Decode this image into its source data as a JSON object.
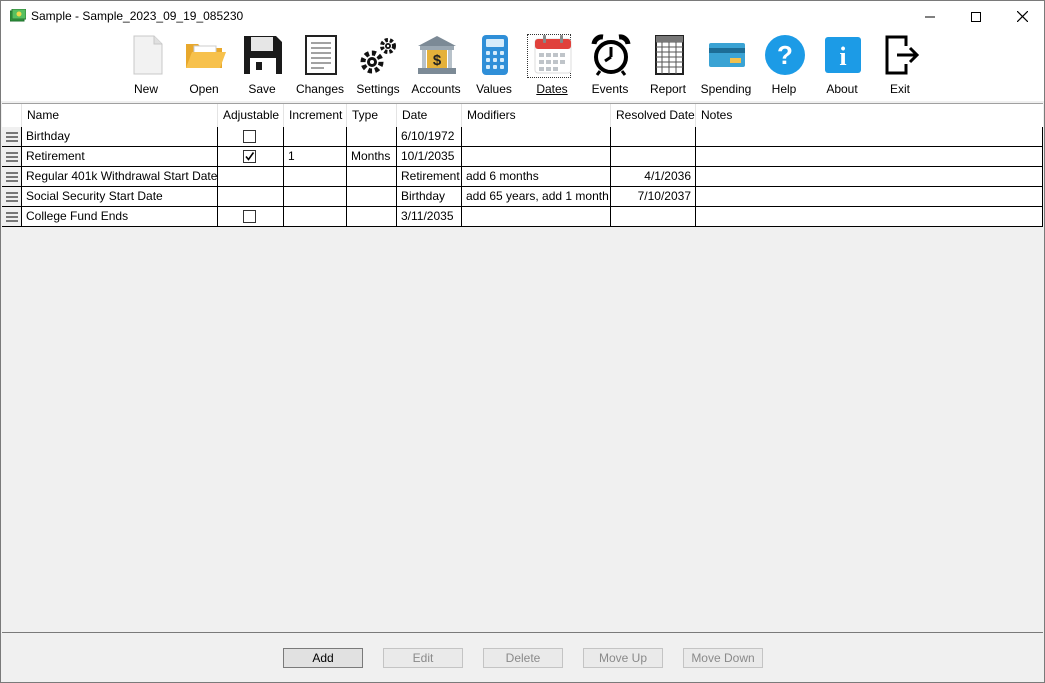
{
  "window": {
    "title": "Sample - Sample_2023_09_19_085230"
  },
  "toolbar": {
    "items": [
      {
        "label": "New",
        "icon": "new-file-icon"
      },
      {
        "label": "Open",
        "icon": "folder-open-icon"
      },
      {
        "label": "Save",
        "icon": "floppy-disk-icon"
      },
      {
        "label": "Changes",
        "icon": "document-changes-icon"
      },
      {
        "label": "Settings",
        "icon": "gears-icon"
      },
      {
        "label": "Accounts",
        "icon": "bank-icon"
      },
      {
        "label": "Values",
        "icon": "calculator-icon"
      },
      {
        "label": "Dates",
        "icon": "calendar-icon",
        "active": true
      },
      {
        "label": "Events",
        "icon": "alarm-clock-icon"
      },
      {
        "label": "Report",
        "icon": "spreadsheet-icon"
      },
      {
        "label": "Spending",
        "icon": "credit-card-icon"
      },
      {
        "label": "Help",
        "icon": "help-icon"
      },
      {
        "label": "About",
        "icon": "info-icon"
      },
      {
        "label": "Exit",
        "icon": "exit-icon"
      }
    ]
  },
  "grid": {
    "columns": [
      "Name",
      "Adjustable",
      "Increment",
      "Type",
      "Date",
      "Modifiers",
      "Resolved Date",
      "Notes"
    ],
    "rows": [
      {
        "name": "Birthday",
        "adjustable": false,
        "increment": "",
        "type": "",
        "date": "6/10/1972",
        "modifiers": "",
        "resolved_date": "",
        "notes": ""
      },
      {
        "name": "Retirement",
        "adjustable": true,
        "increment": "1",
        "type": "Months",
        "date": "10/1/2035",
        "modifiers": "",
        "resolved_date": "",
        "notes": ""
      },
      {
        "name": "Regular 401k Withdrawal Start Date",
        "adjustable": null,
        "increment": "",
        "type": "",
        "date": "Retirement",
        "modifiers": "add 6 months",
        "resolved_date": "4/1/2036",
        "notes": ""
      },
      {
        "name": "Social Security Start Date",
        "adjustable": null,
        "increment": "",
        "type": "",
        "date": "Birthday",
        "modifiers": "add 65 years, add 1 month",
        "resolved_date": "7/10/2037",
        "notes": ""
      },
      {
        "name": "College Fund Ends",
        "adjustable": false,
        "increment": "",
        "type": "",
        "date": "3/11/2035",
        "modifiers": "",
        "resolved_date": "",
        "notes": ""
      }
    ]
  },
  "footer": {
    "add_label": "Add",
    "edit_label": "Edit",
    "delete_label": "Delete",
    "move_up_label": "Move Up",
    "move_down_label": "Move Down"
  }
}
